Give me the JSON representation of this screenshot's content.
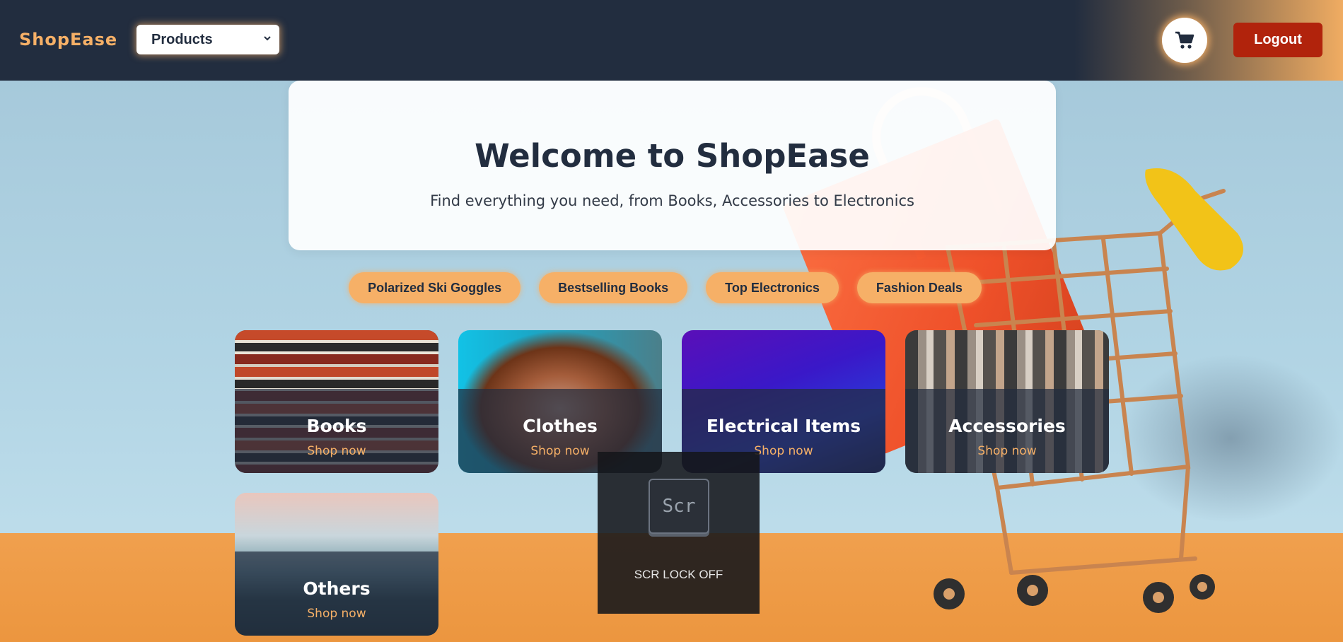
{
  "header": {
    "brand": "ShopEase",
    "category_select": {
      "selected": "Products"
    },
    "cart_icon": "shopping-cart-icon",
    "logout_label": "Logout"
  },
  "hero": {
    "title": "Welcome to ShopEase",
    "subtitle": "Find everything you need, from Books, Accessories to Electronics"
  },
  "chips": [
    {
      "label": "Polarized Ski Goggles"
    },
    {
      "label": "Bestselling Books"
    },
    {
      "label": "Top Electronics"
    },
    {
      "label": "Fashion Deals"
    }
  ],
  "categories": [
    {
      "title": "Books",
      "cta": "Shop now"
    },
    {
      "title": "Clothes",
      "cta": "Shop now"
    },
    {
      "title": "Electrical Items",
      "cta": "Shop now"
    },
    {
      "title": "Accessories",
      "cta": "Shop now"
    },
    {
      "title": "Others",
      "cta": "Shop now"
    }
  ],
  "scroll_lock_overlay": {
    "key_label": "Scr",
    "message": "SCR LOCK OFF"
  },
  "colors": {
    "navbar": "#222d3f",
    "accent": "#f6b067",
    "logout": "#b1230c"
  }
}
